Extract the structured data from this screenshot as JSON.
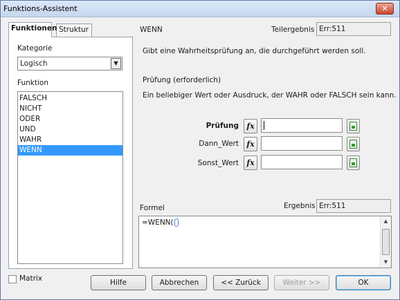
{
  "window": {
    "title": "Funktions-Assistent",
    "close_glyph": "✕"
  },
  "tabs": [
    {
      "label": "Funktionen",
      "active": true
    },
    {
      "label": "Struktur",
      "active": false
    }
  ],
  "left": {
    "category_label": "Kategorie",
    "category_value": "Logisch",
    "function_label": "Funktion",
    "functions": [
      "FALSCH",
      "NICHT",
      "ODER",
      "UND",
      "WAHR",
      "WENN"
    ],
    "selected_function": "WENN",
    "matrix_label": "Matrix"
  },
  "right": {
    "function_name": "WENN",
    "partial_result_label": "Teilergebnis",
    "partial_result_value": "Err:511",
    "description": "Gibt eine Wahrheitsprüfung an, die durchgeführt werden soll.",
    "param_title": "Prüfung (erforderlich)",
    "param_desc": "Ein beliebiger Wert oder Ausdruck, der WAHR oder FALSCH sein kann.",
    "arguments": [
      {
        "label": "Prüfung",
        "value": ""
      },
      {
        "label": "Dann_Wert",
        "value": ""
      },
      {
        "label": "Sonst_Wert",
        "value": ""
      }
    ],
    "fx_glyph": "fx",
    "formula_label": "Formel",
    "result_label": "Ergebnis",
    "result_value": "Err:511",
    "formula_value": "=WENN("
  },
  "buttons": {
    "help": "Hilfe",
    "cancel": "Abbrechen",
    "back": "<< Zurück",
    "next": "Weiter >>",
    "ok": "OK"
  }
}
